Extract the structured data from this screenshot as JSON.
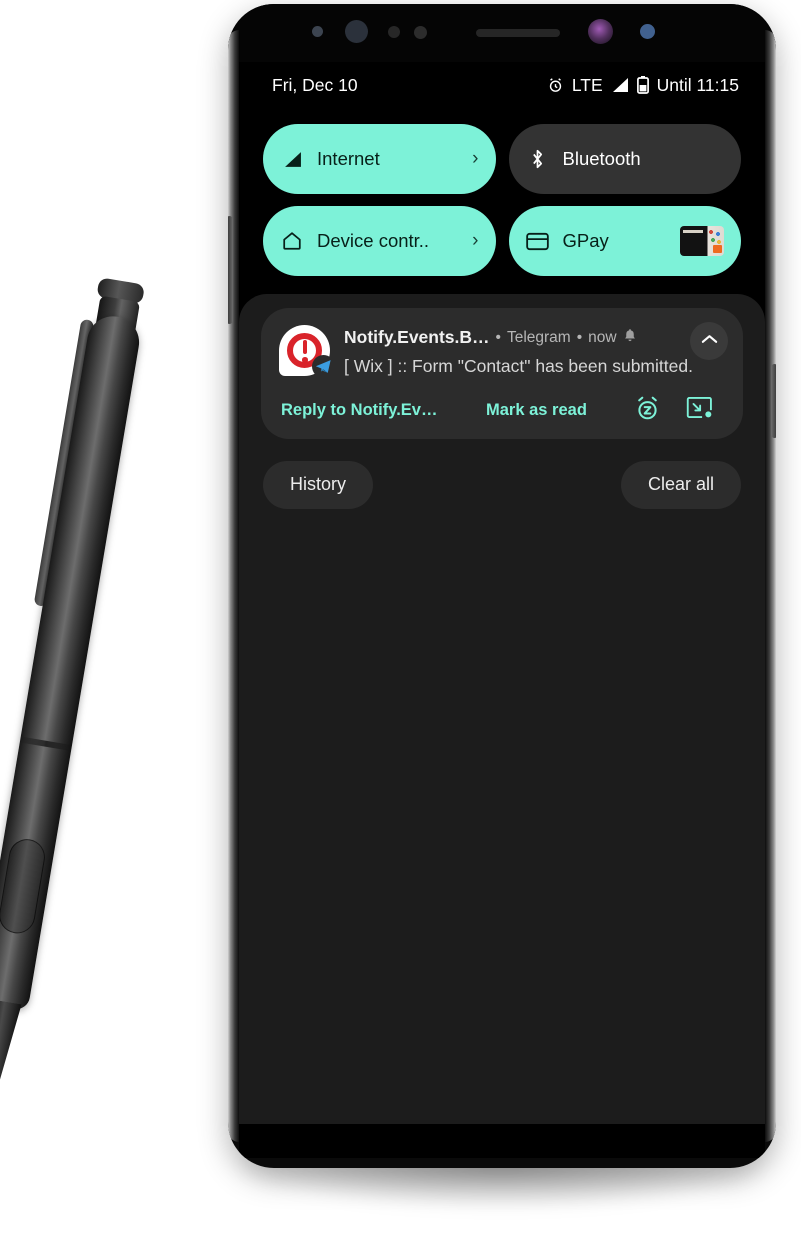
{
  "statusbar": {
    "date": "Fri, Dec 10",
    "alarm_icon": "alarm-clock-icon",
    "network_type": "LTE",
    "signal_icon": "signal-triangle-icon",
    "battery_icon": "battery-icon",
    "battery_text": "Until 11:15"
  },
  "quick_settings": {
    "tiles": [
      {
        "label": "Internet",
        "icon": "signal-triangle-icon",
        "state": "on",
        "chevron": "›"
      },
      {
        "label": "Bluetooth",
        "icon": "bluetooth-icon",
        "state": "off",
        "chevron": ""
      },
      {
        "label": "Device contr..",
        "icon": "home-icon",
        "state": "on",
        "chevron": "›"
      },
      {
        "label": "GPay",
        "icon": "credit-card-icon",
        "state": "on",
        "chevron": ""
      }
    ]
  },
  "notification": {
    "app_icon": "notify-events-icon",
    "badge_icon": "telegram-icon",
    "title": "Notify.Events.B…",
    "separator_1": "•",
    "app_name": "Telegram",
    "separator_2": "•",
    "time": "now",
    "bell_icon": "bell-icon",
    "collapse_icon": "chevron-up-icon",
    "text": "[ Wix ] :: Form \"Contact\" has been submitted.",
    "actions": {
      "reply": "Reply to Notify.Ev…",
      "mark_as_read": "Mark as read",
      "snooze_icon": "snooze-alarm-icon",
      "bubble_icon": "minimize-bubble-icon"
    }
  },
  "shade_buttons": {
    "history": "History",
    "clear_all": "Clear all"
  },
  "colors": {
    "accent_mint": "#7df2d8",
    "tile_off": "#333333",
    "shade_bg": "#1c1c1c",
    "card_bg": "#2c2c2c",
    "screen_bg": "#000000"
  }
}
